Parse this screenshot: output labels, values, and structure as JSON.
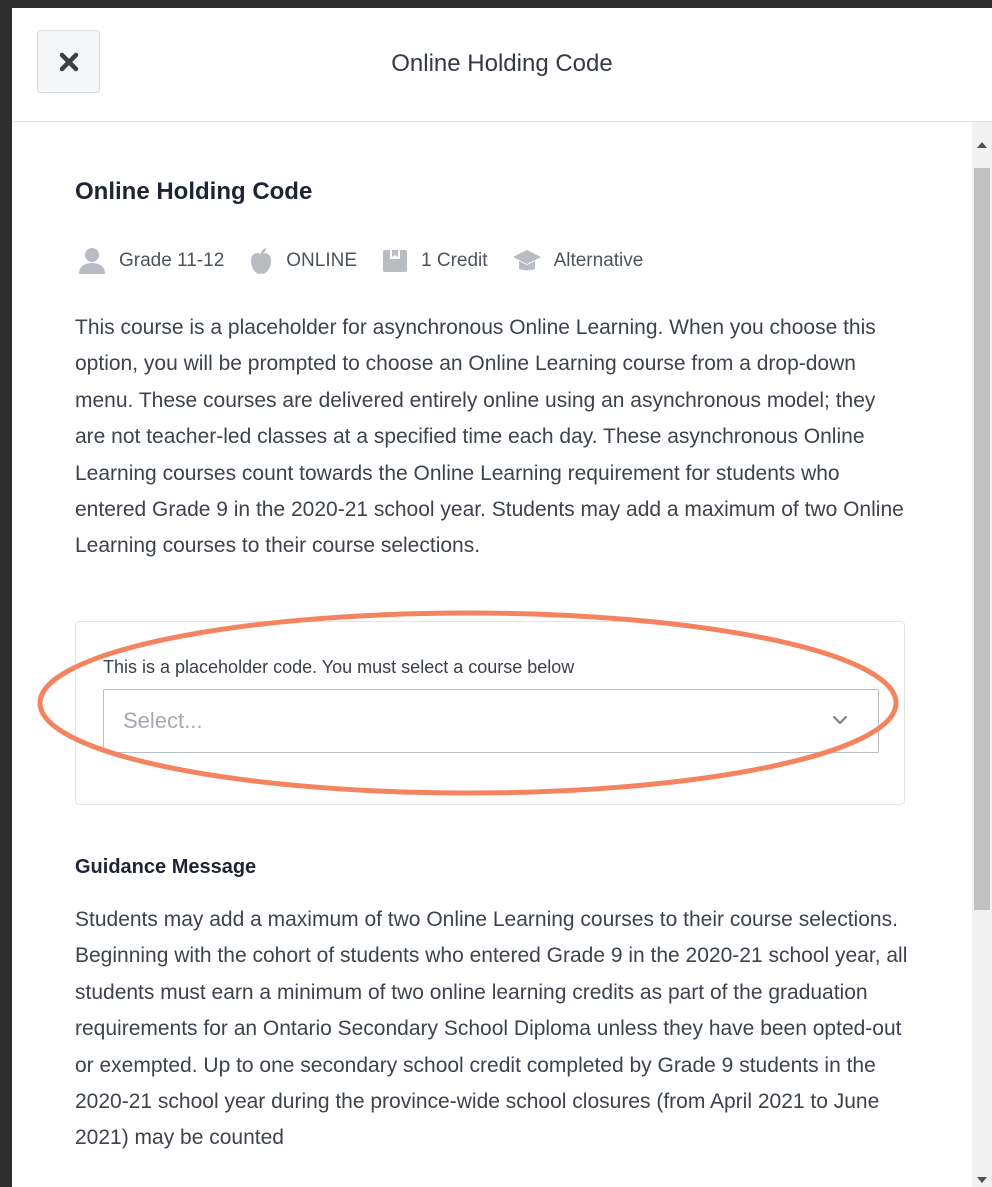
{
  "header": {
    "title": "Online Holding Code",
    "close_icon": "close-icon"
  },
  "course": {
    "title": "Online Holding Code",
    "meta": {
      "grade": "Grade 11-12",
      "delivery": "ONLINE",
      "credit": "1 Credit",
      "type": "Alternative"
    },
    "description": "This course is a placeholder for asynchronous Online Learning. When you choose this option, you will be prompted to choose an Online Learning course from a drop-down menu. These courses are delivered entirely online using an asynchronous model; they are not teacher-led classes at a specified time each day. These asynchronous Online Learning courses count towards the Online Learning requirement for students who entered Grade 9 in the 2020-21 school year. Students may add a maximum of two Online Learning courses to their course selections."
  },
  "selector": {
    "label": "This is a placeholder code. You must select a course below",
    "placeholder": "Select...",
    "highlight_color": "#f4845f"
  },
  "guidance": {
    "title": "Guidance Message",
    "paragraph1": "Students may add a maximum of two Online Learning courses to their course selections.",
    "paragraph2": "Beginning with the cohort of students who entered Grade 9 in the 2020-21 school year, all students must earn a minimum of two online learning credits as part of the graduation requirements for an Ontario Secondary School Diploma unless they have been opted-out or exempted. Up to one secondary school credit completed by Grade 9 students in the 2020-21 school year during the province-wide school closures (from April 2021 to June 2021) may be counted"
  }
}
